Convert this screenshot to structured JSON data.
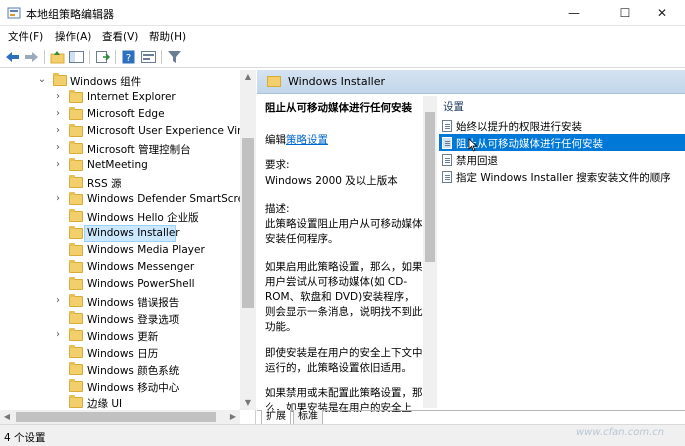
{
  "window": {
    "title": "本地组策略编辑器",
    "minimize_glyph": "—",
    "maximize_glyph": "☐",
    "close_glyph": "✕"
  },
  "menu": [
    "文件(F)",
    "操作(A)",
    "查看(V)",
    "帮助(H)"
  ],
  "toolbar_icons": [
    "back-icon",
    "forward-icon",
    "up-folder-icon",
    "show-hide-tree-icon",
    "export-list-icon",
    "help-icon",
    "properties-icon",
    "filter-icon"
  ],
  "tree": {
    "items": [
      {
        "label": "Windows 组件",
        "expanded": true
      },
      {
        "label": "Internet Explorer"
      },
      {
        "label": "Microsoft Edge"
      },
      {
        "label": "Microsoft User Experience Virtu"
      },
      {
        "label": "Microsoft 管理控制台"
      },
      {
        "label": "NetMeeting"
      },
      {
        "label": "RSS 源"
      },
      {
        "label": "Windows Defender SmartScree"
      },
      {
        "label": "Windows Hello 企业版"
      },
      {
        "label": "Windows Installer",
        "selected": true
      },
      {
        "label": "Windows Media Player"
      },
      {
        "label": "Windows Messenger"
      },
      {
        "label": "Windows PowerShell"
      },
      {
        "label": "Windows 错误报告"
      },
      {
        "label": "Windows 登录选项"
      },
      {
        "label": "Windows 更新"
      },
      {
        "label": "Windows 日历"
      },
      {
        "label": "Windows 颜色系统"
      },
      {
        "label": "Windows 移动中心"
      },
      {
        "label": "边缘 UI"
      }
    ]
  },
  "right": {
    "header_title": "Windows Installer",
    "policy_title": "阻止从可移动媒体进行任何安装",
    "edit_prefix": "编辑",
    "edit_link": "策略设置",
    "req_label": "要求:",
    "req_value": "Windows 2000 及以上版本",
    "desc_label": "描述:",
    "desc_text": "此策略设置阻止用户从可移动媒体安装任何程序。",
    "para1": "如果启用此策略设置，那么，如果用户尝试从可移动媒体(如 CD-ROM、软盘和 DVD)安装程序，则会显示一条消息，说明找不到此功能。",
    "para2": "即使安装是在用户的安全上下文中运行的，此策略设置依旧适用。",
    "para3": "如果禁用或未配置此策略设置，那么，如果安装是在用户的安全上",
    "list_header": "设置",
    "list": [
      {
        "label": "始终以提升的权限进行安装"
      },
      {
        "label": "阻止从可移动媒体进行任何安装",
        "selected": true
      },
      {
        "label": "禁用回退"
      },
      {
        "label": "指定 Windows Installer 搜索安装文件的顺序"
      }
    ],
    "tabs": [
      "扩展",
      "标准"
    ]
  },
  "status": "4 个设置",
  "watermark": "www.cfan.com.cn",
  "colors": {
    "selection": "#0078d7",
    "link": "#0066cc",
    "folder": "#f2cf6b"
  }
}
